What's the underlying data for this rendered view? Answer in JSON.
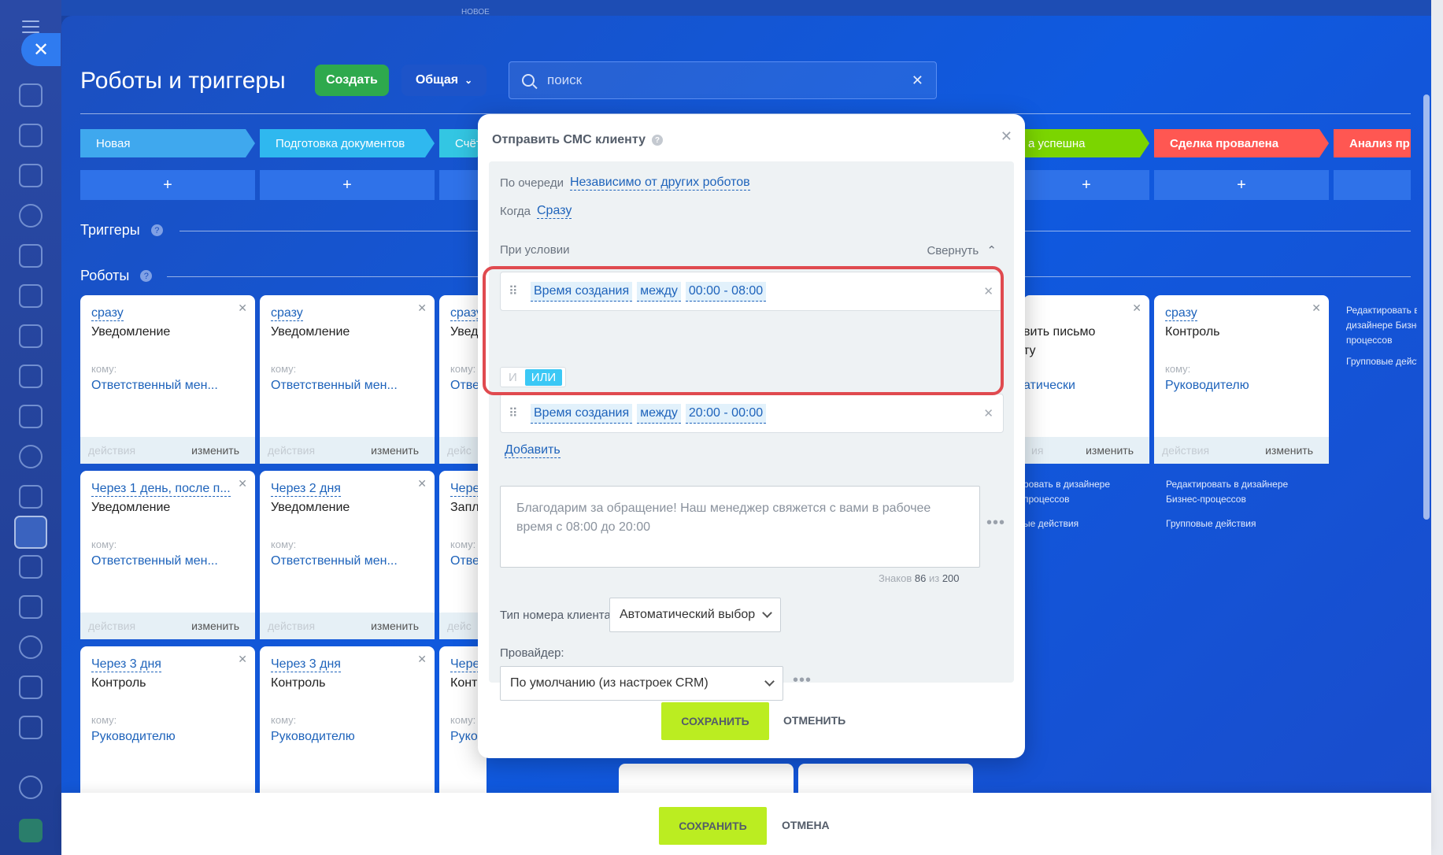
{
  "top": {
    "new_tag": "НОВОЕ"
  },
  "header": {
    "title": "Роботы и триггеры",
    "create_label": "Создать",
    "general_label": "Общая",
    "search_placeholder": "поиск"
  },
  "stages": [
    {
      "label": "Новая",
      "color": "#3fa8ee"
    },
    {
      "label": "Подготовка документов",
      "color": "#2fb8ef"
    },
    {
      "label": "Счёт",
      "color": "#33c6e3"
    },
    {
      "label": "а успешна",
      "color": "#7bd500"
    },
    {
      "label": "Сделка провалена",
      "color": "#ff5752"
    },
    {
      "label": "Анализ пр",
      "color": "#ff5752"
    }
  ],
  "plus_label": "+",
  "sections": {
    "triggers": "Триггеры",
    "robots": "Роботы",
    "help": "?"
  },
  "cards": {
    "c1": {
      "when": "сразу",
      "title": "Уведомление",
      "to": "кому:",
      "who": "Ответственный мен...",
      "actions": "действия",
      "edit": "изменить"
    },
    "c2": {
      "when": "сразу",
      "title": "Уведомление",
      "to": "кому:",
      "who": "Ответственный мен...",
      "actions": "действия",
      "edit": "изменить"
    },
    "c3": {
      "when": "сразу",
      "title": "Увед",
      "to": "кому:",
      "who": "Отве",
      "actions": "дейс"
    },
    "c4": {
      "title": "вить письмо",
      "title2": "ту",
      "who": "атически",
      "actions": "ия",
      "edit": "изменить"
    },
    "c5": {
      "when": "сразу",
      "title": "Контроль",
      "to": "кому:",
      "who": "Руководителю",
      "actions": "действия",
      "edit": "изменить"
    },
    "c6": {
      "when": "Через 1 день, после п...",
      "title": "Уведомление",
      "to": "кому:",
      "who": "Ответственный мен...",
      "actions": "действия",
      "edit": "изменить"
    },
    "c7": {
      "when": "Через 2 дня",
      "title": "Уведомление",
      "to": "кому:",
      "who": "Ответственный мен...",
      "actions": "действия",
      "edit": "изменить"
    },
    "c8": {
      "when": "Чере",
      "title": "Запл",
      "to": "кому:",
      "who": "Отве",
      "actions": "дейс"
    },
    "c9": {
      "when": "Через 3 дня",
      "title": "Контроль",
      "to": "кому:",
      "who": "Руководителю"
    },
    "c10": {
      "when": "Через 3 дня",
      "title": "Контроль",
      "to": "кому:",
      "who": "Руководителю"
    },
    "c11": {
      "when": "Чере",
      "title": "Конт",
      "to": "кому:",
      "who": "Руко"
    }
  },
  "side_links": {
    "col_a": {
      "edit_bp": "Редактировать в дизайнере Бизнес-процессов",
      "group": "Групповые действия"
    },
    "col_b": {
      "edit_bp": "ровать в дизайнере процессов",
      "group": "ые действия"
    },
    "col_c": {
      "edit_bp": "Редактировать в дизайнере Бизнес-процессов",
      "group": "Групповые действия"
    }
  },
  "modal": {
    "title": "Отправить СМС клиенту",
    "queue_label": "По очереди",
    "queue_value": "Независимо от других роботов",
    "when_label": "Когда",
    "when_value": "Сразу",
    "condition_label": "При условии",
    "collapse_label": "Свернуть",
    "conditions": [
      {
        "field": "Время создания",
        "op": "между",
        "value": "00:00 - 08:00"
      },
      {
        "field": "Время создания",
        "op": "между",
        "value": "20:00 - 00:00"
      }
    ],
    "joiner_and": "И",
    "joiner_or": "ИЛИ",
    "add_label": "Добавить",
    "message": "Благодарим за обращение! Наш менеджер свяжется с вами в рабочее время с 08:00 до 20:00",
    "counter_prefix": "Знаков",
    "counter_count": "86",
    "counter_of": "из",
    "counter_max": "200",
    "number_type_label": "Тип номера клиента:",
    "number_type_value": "Автоматический выбор",
    "provider_label": "Провайдер:",
    "provider_value": "По умолчанию (из настроек CRM)",
    "save_label": "СОХРАНИТЬ",
    "cancel_label": "ОТМЕНИТЬ"
  },
  "footer": {
    "save_label": "СОХРАНИТЬ",
    "cancel_label": "ОТМЕНА"
  }
}
